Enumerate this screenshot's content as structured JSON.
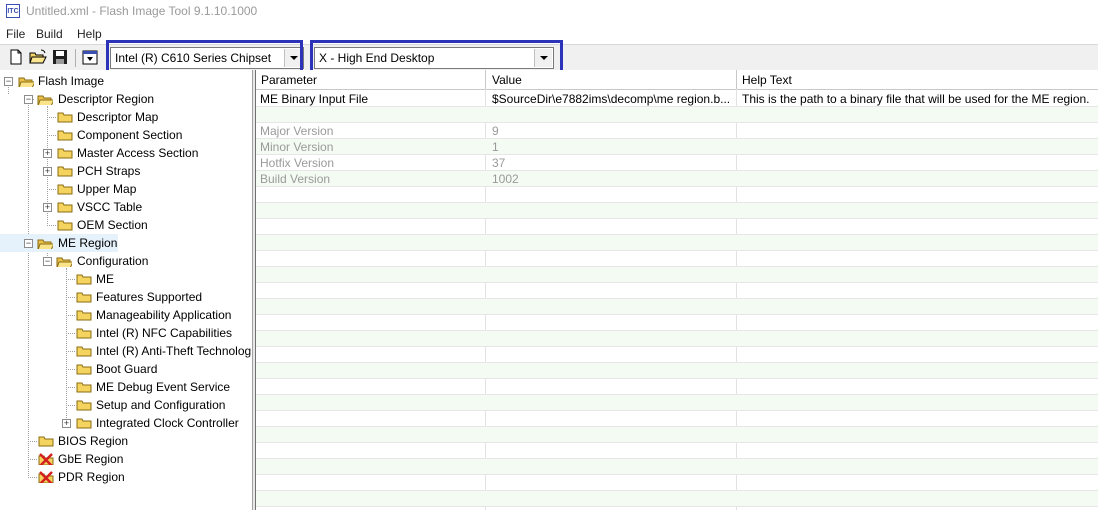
{
  "window": {
    "title": "Untitled.xml - Flash Image Tool 9.1.10.1000",
    "icon_text": "ITC"
  },
  "menu": {
    "items": [
      "File",
      "Build",
      "Help"
    ]
  },
  "toolbar": {
    "buttons": [
      "new-file-icon",
      "open-folder-icon",
      "save-icon",
      "build-image-icon"
    ],
    "chipset_value": "Intel (R) C610 Series Chipset",
    "sku_value": "X - High End Desktop",
    "highlight_color": "#2b34b8"
  },
  "tree": {
    "root": "Flash Image",
    "descriptor_region": "Descriptor Region",
    "descriptor_items": [
      "Descriptor Map",
      "Component Section",
      "Master Access Section",
      "PCH Straps",
      "Upper Map",
      "VSCC Table",
      "OEM Section"
    ],
    "me_region": "ME Region",
    "configuration": "Configuration",
    "config_items": [
      "ME",
      "Features Supported",
      "Manageability Application",
      "Intel (R) NFC Capabilities",
      "Intel (R) Anti-Theft Technolog",
      "Boot Guard",
      "ME Debug Event Service",
      "Setup and Configuration",
      "Integrated Clock Controller"
    ],
    "bios_region": "BIOS Region",
    "gbe_region": "GbE Region",
    "pdr_region": "PDR Region"
  },
  "grid": {
    "headers": [
      "Parameter",
      "Value",
      "Help Text"
    ],
    "rows": [
      {
        "parameter": "ME Binary Input File",
        "value": "$SourceDir\\e7882ims\\decomp\\me region.b...",
        "help": "This is the path to a binary file that will be used for the ME region.",
        "dim": false
      },
      {
        "parameter": "",
        "value": "",
        "help": "",
        "dim": false
      },
      {
        "parameter": "Major Version",
        "value": "9",
        "help": "",
        "dim": true
      },
      {
        "parameter": "Minor Version",
        "value": "1",
        "help": "",
        "dim": true
      },
      {
        "parameter": "Hotfix Version",
        "value": "37",
        "help": "",
        "dim": true
      },
      {
        "parameter": "Build Version",
        "value": "1002",
        "help": "",
        "dim": true
      }
    ]
  }
}
